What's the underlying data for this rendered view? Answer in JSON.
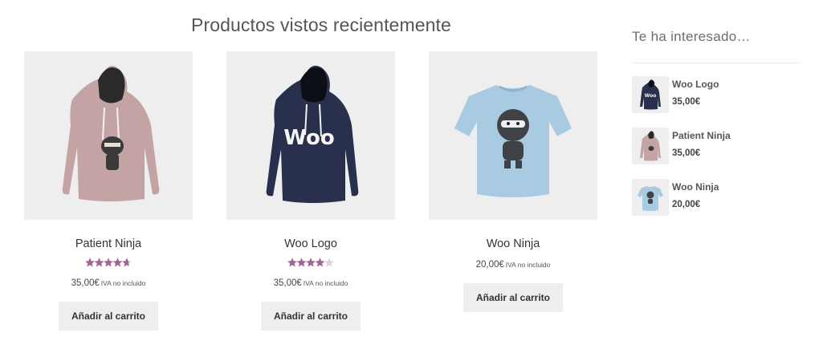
{
  "section": {
    "title": "Productos vistos recientemente"
  },
  "products": [
    {
      "name": "Patient Ninja",
      "rating": 4.67,
      "rating_max": 5,
      "price": "35,00€",
      "tax_note": "IVA no incluido",
      "button": "Añadir al carrito",
      "image": "pink-hoodie-ninja",
      "color": "#c4a3a5"
    },
    {
      "name": "Woo Logo",
      "rating": 4,
      "rating_max": 5,
      "price": "35,00€",
      "tax_note": "IVA no incluido",
      "button": "Añadir al carrito",
      "image": "navy-hoodie-woo-logo",
      "color": "#28304d"
    },
    {
      "name": "Woo Ninja",
      "rating": null,
      "price": "20,00€",
      "tax_note": "IVA no incluido",
      "button": "Añadir al carrito",
      "image": "light-blue-tshirt-ninja",
      "color": "#a9cbe2"
    }
  ],
  "widget": {
    "title": "Te ha interesado…",
    "items": [
      {
        "name": "Woo Logo",
        "price": "35,00€",
        "image": "navy-hoodie-woo-logo"
      },
      {
        "name": "Patient Ninja",
        "price": "35,00€",
        "image": "pink-hoodie-ninja"
      },
      {
        "name": "Woo Ninja",
        "price": "20,00€",
        "image": "light-blue-tshirt-ninja"
      }
    ]
  },
  "colors": {
    "star_filled": "#a16696",
    "star_empty": "#e0d2dd",
    "tile_bg": "#eeeeee",
    "button_bg": "#eeeeee"
  }
}
